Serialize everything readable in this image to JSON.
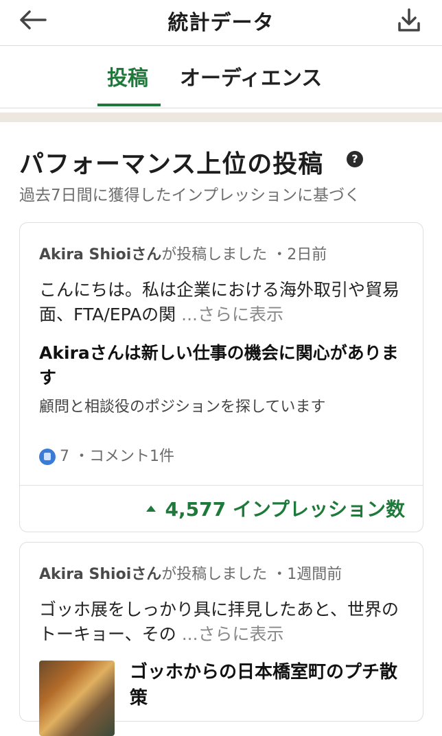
{
  "header": {
    "title": "統計データ",
    "back_icon": "arrow-left-icon",
    "download_icon": "download-icon"
  },
  "tabs": [
    {
      "label": "投稿",
      "active": true
    },
    {
      "label": "オーディエンス",
      "active": false
    }
  ],
  "section": {
    "title": "パフォーマンス上位の投稿",
    "help_icon": "?",
    "subtitle": "過去7日間に獲得したインプレッションに基づく"
  },
  "posts": [
    {
      "author": "Akira Shioiさん",
      "action": "が投稿しました",
      "time": "・2日前",
      "text": "こんにちは。私は企業における海外取引や貿易面、FTA/EPAの関",
      "more": "...さらに表示",
      "headline": "Akiraさんは新しい仕事の機会に関心があります",
      "description": "顧問と相談役のポジションを探しています",
      "reactions": "7",
      "comments": "・コメント1件",
      "impressions": "4,577 インプレッション数"
    },
    {
      "author": "Akira Shioiさん",
      "action": "が投稿しました",
      "time": "・1週間前",
      "text": "ゴッホ展をしっかり具に拝見したあと、世界のトーキョー、その",
      "more": "...さらに表示",
      "link_title": "ゴッホからの日本橋室町のプチ散策"
    }
  ],
  "colors": {
    "accent": "#1e7a3a",
    "band": "#ece8df",
    "like": "#3a7bd5"
  }
}
